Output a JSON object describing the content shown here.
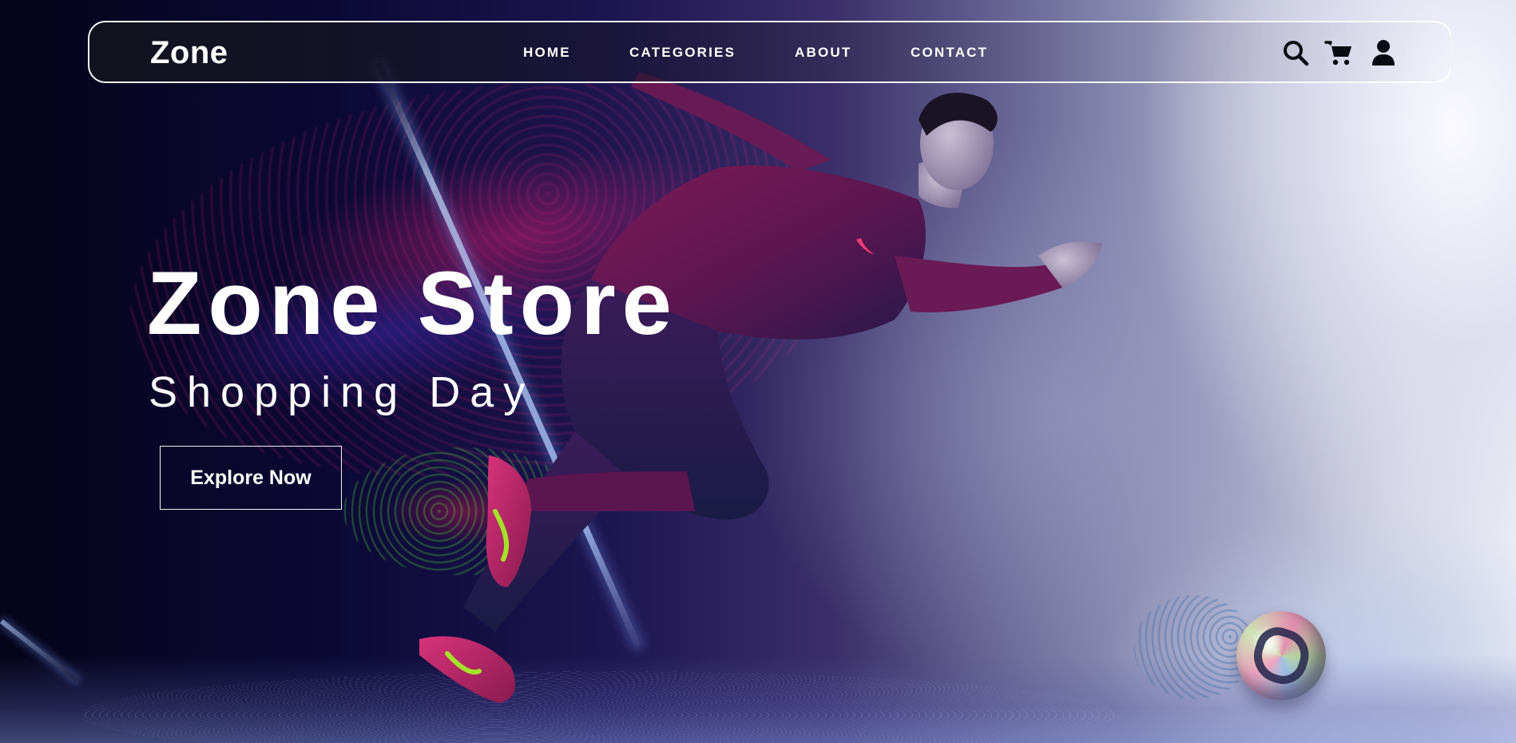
{
  "header": {
    "logo": "Zone",
    "nav": [
      {
        "label": "HOME"
      },
      {
        "label": "CATEGORIES"
      },
      {
        "label": "ABOUT"
      },
      {
        "label": "CONTACT"
      }
    ],
    "icons": [
      "search-icon",
      "cart-icon",
      "user-icon"
    ]
  },
  "hero": {
    "title": "Zone Store",
    "subtitle": "Shopping Day",
    "cta_label": "Explore Now"
  },
  "colors": {
    "text": "#ffffff",
    "accent": "#c2185b",
    "bg_dark": "#0b0934",
    "bg_light": "#ecedf5"
  }
}
